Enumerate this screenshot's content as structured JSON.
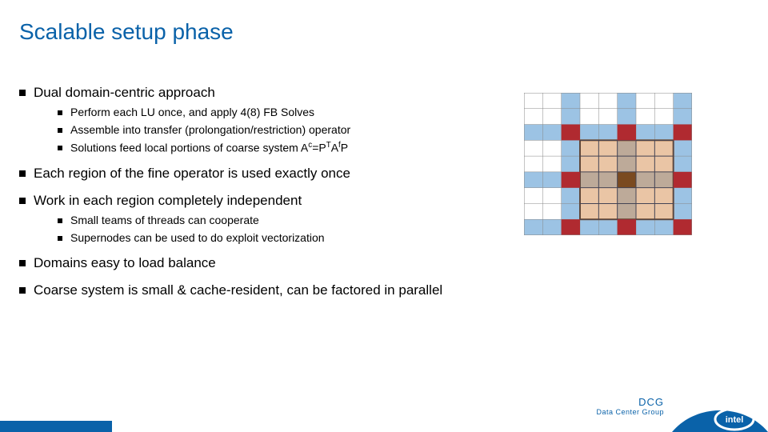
{
  "title": "Scalable setup phase",
  "bullets": {
    "b1_1": "Dual domain-centric approach",
    "b2_1": "Perform each LU once, and apply 4(8) FB Solves",
    "b2_2": "Assemble into transfer (prolongation/restriction) operator",
    "b2_3_pre": "Solutions feed local portions of coarse system A",
    "b2_3_sup1": "c",
    "b2_3_mid": "=P",
    "b2_3_sup2": "T",
    "b2_3_mid2": "A",
    "b2_3_sup3": "f",
    "b2_3_end": "P",
    "b1_2": "Each region of the fine operator is used exactly once",
    "b1_3": "Work in each region completely independent",
    "b2_4": "Small teams of threads can cooperate",
    "b2_5": "Supernodes can be used to do exploit vectorization",
    "b1_4": "Domains easy to load balance",
    "b1_5": "Coarse system is small & cache-resident, can be factored in parallel"
  },
  "footer": {
    "dcg": "DCG",
    "group": "Data Center Group"
  },
  "diagram": {
    "grid_n": 9,
    "blue_cols": [
      2,
      5,
      8
    ],
    "blue_rows": [
      2,
      5,
      8
    ],
    "red_nodes": [
      [
        2,
        2
      ],
      [
        2,
        5
      ],
      [
        2,
        8
      ],
      [
        5,
        2
      ],
      [
        5,
        8
      ],
      [
        8,
        2
      ],
      [
        8,
        5
      ],
      [
        8,
        8
      ]
    ],
    "highlight_center": [
      5,
      5
    ],
    "highlight_half": 2
  },
  "colors": {
    "blue_band": "#9cc3e4",
    "grid_line": "#445",
    "red": "#b02a30",
    "orange_fill": "#d9955b",
    "orange_stroke": "#7a4a20",
    "intel_blue": "#0a62a9"
  }
}
